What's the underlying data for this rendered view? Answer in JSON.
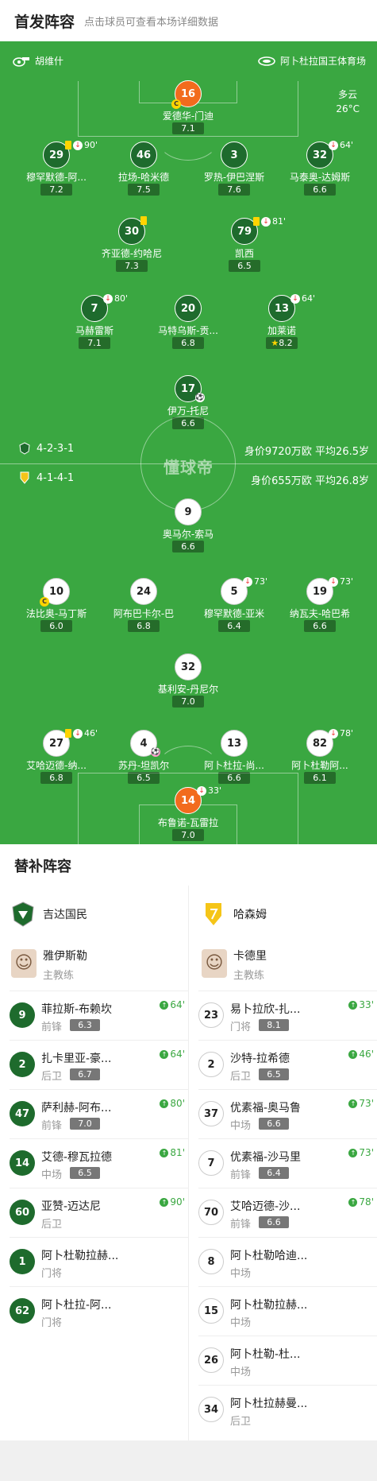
{
  "header": {
    "title": "首发阵容",
    "subtitle": "点击球员可查看本场详细数据"
  },
  "pitch": {
    "referee": "胡维什",
    "venue": "阿卜杜拉国王体育场",
    "weather": "多云",
    "temperature": "26°C",
    "watermark": "懂球帝",
    "home_formation": "4-2-3-1",
    "home_value": "身价9720万欧 平均26.5岁",
    "away_formation": "4-1-4-1",
    "away_value": "身价655万欧 平均26.8岁",
    "home": [
      {
        "num": "16",
        "name": "爱德华-门迪",
        "rating": "7.1"
      },
      {
        "num": "29",
        "name": "穆罕默德-阿...",
        "rating": "7.2",
        "ev": "90'"
      },
      {
        "num": "46",
        "name": "拉场-哈米德",
        "rating": "7.5"
      },
      {
        "num": "3",
        "name": "罗热-伊巴涅斯",
        "rating": "7.6"
      },
      {
        "num": "32",
        "name": "马泰奥-达姆斯",
        "rating": "6.6",
        "ev": "64'"
      },
      {
        "num": "30",
        "name": "齐亚德-约哈尼",
        "rating": "7.3"
      },
      {
        "num": "79",
        "name": "凯西",
        "rating": "6.5",
        "ev": "81'"
      },
      {
        "num": "7",
        "name": "马赫雷斯",
        "rating": "7.1",
        "ev": "80'"
      },
      {
        "num": "20",
        "name": "马特乌斯-贡...",
        "rating": "6.8"
      },
      {
        "num": "13",
        "name": "加莱诺",
        "rating": "8.2",
        "ev": "64'"
      },
      {
        "num": "17",
        "name": "伊万-托尼",
        "rating": "6.6"
      }
    ],
    "away": [
      {
        "num": "9",
        "name": "奥马尔-索马",
        "rating": "6.6"
      },
      {
        "num": "10",
        "name": "法比奥-马丁斯",
        "rating": "6.0"
      },
      {
        "num": "24",
        "name": "阿布巴卡尔-巴",
        "rating": "6.8"
      },
      {
        "num": "5",
        "name": "穆罕默德-亚米",
        "rating": "6.4",
        "ev": "73'"
      },
      {
        "num": "19",
        "name": "纳瓦夫-哈巴希",
        "rating": "6.6",
        "ev": "73'"
      },
      {
        "num": "32",
        "name": "基利安-丹尼尔",
        "rating": "7.0"
      },
      {
        "num": "27",
        "name": "艾哈迈德-纳...",
        "rating": "6.8",
        "ev": "46'"
      },
      {
        "num": "4",
        "name": "苏丹-坦凯尔",
        "rating": "6.5"
      },
      {
        "num": "13",
        "name": "阿卜杜拉-尚...",
        "rating": "6.6"
      },
      {
        "num": "82",
        "name": "阿卜杜勒阿...",
        "rating": "6.1",
        "ev": "78'"
      },
      {
        "num": "14",
        "name": "布鲁诺-瓦雷拉",
        "rating": "7.0",
        "ev": "33'"
      }
    ]
  },
  "subs": {
    "title": "替补阵容",
    "home_team": "吉达国民",
    "away_team": "哈森姆",
    "home_coach": {
      "name": "雅伊斯勒",
      "role": "主教练"
    },
    "away_coach": {
      "name": "卡德里",
      "role": "主教练"
    },
    "home": [
      {
        "num": "9",
        "name": "菲拉斯-布赖坎",
        "pos": "前锋",
        "rating": "6.3",
        "in": "64'"
      },
      {
        "num": "2",
        "name": "扎卡里亚-豪...",
        "pos": "后卫",
        "rating": "6.7",
        "in": "64'"
      },
      {
        "num": "47",
        "name": "萨利赫-阿布...",
        "pos": "前锋",
        "rating": "7.0",
        "in": "80'"
      },
      {
        "num": "14",
        "name": "艾德-穆瓦拉德",
        "pos": "中场",
        "rating": "6.5",
        "in": "81'"
      },
      {
        "num": "60",
        "name": "亚赞-迈达尼",
        "pos": "后卫",
        "in": "90'"
      },
      {
        "num": "1",
        "name": "阿卜杜勒拉赫...",
        "pos": "门将"
      },
      {
        "num": "62",
        "name": "阿卜杜拉-阿...",
        "pos": "门将"
      }
    ],
    "away": [
      {
        "num": "23",
        "name": "易卜拉欣-扎...",
        "pos": "门将",
        "rating": "8.1",
        "in": "33'"
      },
      {
        "num": "2",
        "name": "沙特-拉希德",
        "pos": "后卫",
        "rating": "6.5",
        "in": "46'"
      },
      {
        "num": "37",
        "name": "优素福-奥马鲁",
        "pos": "中场",
        "rating": "6.6",
        "in": "73'"
      },
      {
        "num": "7",
        "name": "优素福-沙马里",
        "pos": "前锋",
        "rating": "6.4",
        "in": "73'"
      },
      {
        "num": "70",
        "name": "艾哈迈德-沙...",
        "pos": "前锋",
        "rating": "6.6",
        "in": "78'"
      },
      {
        "num": "8",
        "name": "阿卜杜勒哈迪...",
        "pos": "中场"
      },
      {
        "num": "15",
        "name": "阿卜杜勒拉赫...",
        "pos": "中场"
      },
      {
        "num": "26",
        "name": "阿卜杜勒-杜...",
        "pos": "中场"
      },
      {
        "num": "34",
        "name": "阿卜杜拉赫曼...",
        "pos": "后卫"
      }
    ]
  },
  "colors": {
    "pitch": "#3aa741",
    "home": "#1e6b2d",
    "gk": "#f26b1d",
    "sub_in": "#3aa741"
  }
}
